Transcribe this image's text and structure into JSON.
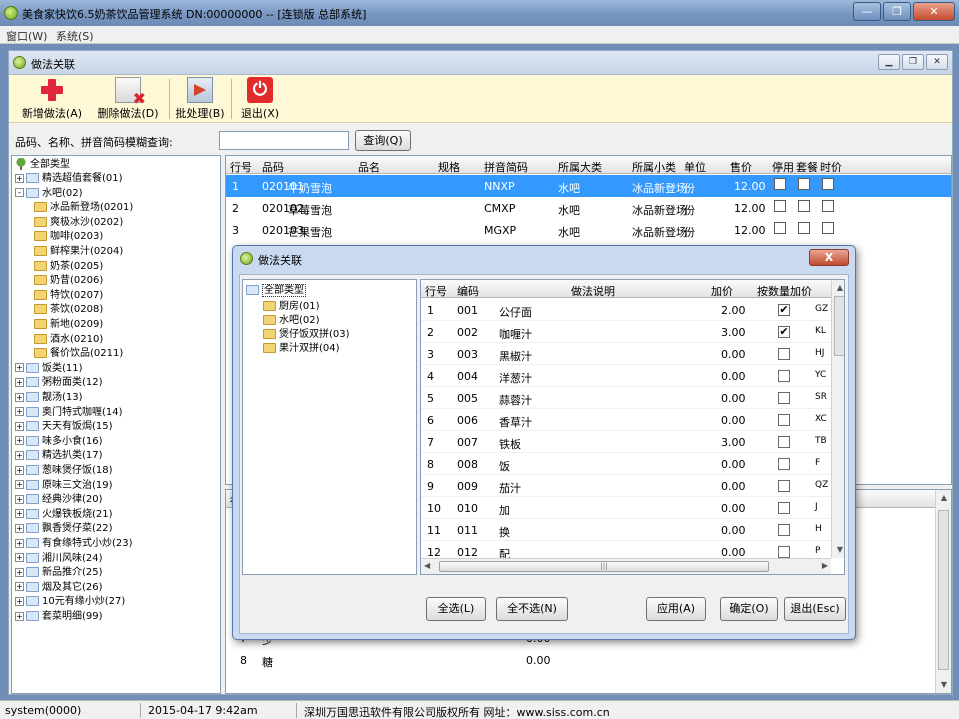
{
  "window": {
    "title": "美食家快饮6.5奶茶饮品管理系统 DN:00000000 -- [连锁版 总部系统]"
  },
  "menubar": {
    "items": [
      "窗口(W)",
      "系统(S)"
    ]
  },
  "child": {
    "title": "做法关联"
  },
  "toolbar": {
    "add": "新增做法(A)",
    "delete": "删除做法(D)",
    "batch": "批处理(B)",
    "exit": "退出(X)"
  },
  "search": {
    "label": "品码、名称、拼音简码模糊查询:",
    "value": "",
    "button": "查询(Q)"
  },
  "tree": {
    "root": "全部类型",
    "items": [
      {
        "label": "精选超值套餐(01)",
        "level": 1,
        "exp": "+"
      },
      {
        "label": "水吧(02)",
        "level": 1,
        "exp": "-"
      },
      {
        "label": "冰品新登场(0201)",
        "level": 2,
        "exp": ""
      },
      {
        "label": "爽极冰沙(0202)",
        "level": 2,
        "exp": ""
      },
      {
        "label": "咖啡(0203)",
        "level": 2,
        "exp": ""
      },
      {
        "label": "鲜榨果汁(0204)",
        "level": 2,
        "exp": ""
      },
      {
        "label": "奶茶(0205)",
        "level": 2,
        "exp": ""
      },
      {
        "label": "奶昔(0206)",
        "level": 2,
        "exp": ""
      },
      {
        "label": "特饮(0207)",
        "level": 2,
        "exp": ""
      },
      {
        "label": "茶饮(0208)",
        "level": 2,
        "exp": ""
      },
      {
        "label": "新地(0209)",
        "level": 2,
        "exp": ""
      },
      {
        "label": "酒水(0210)",
        "level": 2,
        "exp": ""
      },
      {
        "label": "餐价饮品(0211)",
        "level": 2,
        "exp": ""
      },
      {
        "label": "饭类(11)",
        "level": 1,
        "exp": "+"
      },
      {
        "label": "粥粉面类(12)",
        "level": 1,
        "exp": "+"
      },
      {
        "label": "靓汤(13)",
        "level": 1,
        "exp": "+"
      },
      {
        "label": "奥门特式咖喱(14)",
        "level": 1,
        "exp": "+"
      },
      {
        "label": "天天有饭焗(15)",
        "level": 1,
        "exp": "+"
      },
      {
        "label": "味多小食(16)",
        "level": 1,
        "exp": "+"
      },
      {
        "label": "精选扒类(17)",
        "level": 1,
        "exp": "+"
      },
      {
        "label": "葱味煲仔饭(18)",
        "level": 1,
        "exp": "+"
      },
      {
        "label": "原味三文治(19)",
        "level": 1,
        "exp": "+"
      },
      {
        "label": "经典沙律(20)",
        "level": 1,
        "exp": "+"
      },
      {
        "label": "火爆铁板烧(21)",
        "level": 1,
        "exp": "+"
      },
      {
        "label": "飘香煲仔菜(22)",
        "level": 1,
        "exp": "+"
      },
      {
        "label": "有食缘特式小炒(23)",
        "level": 1,
        "exp": "+"
      },
      {
        "label": "湘川风味(24)",
        "level": 1,
        "exp": "+"
      },
      {
        "label": "新品推介(25)",
        "level": 1,
        "exp": "+"
      },
      {
        "label": "烟及其它(26)",
        "level": 1,
        "exp": "+"
      },
      {
        "label": "10元有缘小炒(27)",
        "level": 1,
        "exp": "+"
      },
      {
        "label": "套菜明细(99)",
        "level": 1,
        "exp": "+"
      }
    ]
  },
  "grid": {
    "headers": [
      "行号",
      "品码",
      "品名",
      "规格",
      "拼音简码",
      "所属大类",
      "所属小类",
      "单位",
      "售价",
      "停用",
      "套餐",
      "时价"
    ],
    "rows": [
      [
        "1",
        "020101",
        "牛奶雪泡",
        "",
        "NNXP",
        "水吧",
        "冰品新登场",
        "份",
        "12.00"
      ],
      [
        "2",
        "020102",
        "草莓雪泡",
        "",
        "CMXP",
        "水吧",
        "冰品新登场",
        "份",
        "12.00"
      ],
      [
        "3",
        "020103",
        "芒果雪泡",
        "",
        "MGXP",
        "水吧",
        "冰品新登场",
        "份",
        "12.00"
      ]
    ]
  },
  "grid2": {
    "header_first": "行",
    "rows": [
      [
        "7",
        "少",
        "0.00"
      ],
      [
        "8",
        "糖",
        "0.00"
      ]
    ]
  },
  "dialog": {
    "title": "做法关联",
    "close": "X",
    "tree": {
      "root": "全部类型",
      "items": [
        "厨房(01)",
        "水吧(02)",
        "煲仔饭双拼(03)",
        "果汁双拼(04)"
      ]
    },
    "headers": [
      "行号",
      "编码",
      "做法说明",
      "加价",
      "按数量加价",
      ""
    ],
    "rows": [
      {
        "n": "1",
        "code": "001",
        "desc": "公仔面",
        "price": "2.00",
        "checked": true,
        "py": "GZ"
      },
      {
        "n": "2",
        "code": "002",
        "desc": "咖喱汁",
        "price": "3.00",
        "checked": true,
        "py": "KL"
      },
      {
        "n": "3",
        "code": "003",
        "desc": "黑椒汁",
        "price": "0.00",
        "checked": false,
        "py": "HJ"
      },
      {
        "n": "4",
        "code": "004",
        "desc": "洋葱汁",
        "price": "0.00",
        "checked": false,
        "py": "YC"
      },
      {
        "n": "5",
        "code": "005",
        "desc": "蒜蓉汁",
        "price": "0.00",
        "checked": false,
        "py": "SR"
      },
      {
        "n": "6",
        "code": "006",
        "desc": "香草汁",
        "price": "0.00",
        "checked": false,
        "py": "XC"
      },
      {
        "n": "7",
        "code": "007",
        "desc": "铁板",
        "price": "3.00",
        "checked": false,
        "py": "TB"
      },
      {
        "n": "8",
        "code": "008",
        "desc": "饭",
        "price": "0.00",
        "checked": false,
        "py": "F"
      },
      {
        "n": "9",
        "code": "009",
        "desc": "茄汁",
        "price": "0.00",
        "checked": false,
        "py": "QZ"
      },
      {
        "n": "10",
        "code": "010",
        "desc": "加",
        "price": "0.00",
        "checked": false,
        "py": "J"
      },
      {
        "n": "11",
        "code": "011",
        "desc": "换",
        "price": "0.00",
        "checked": false,
        "py": "H"
      },
      {
        "n": "12",
        "code": "012",
        "desc": "配",
        "price": "0.00",
        "checked": false,
        "py": "P"
      }
    ],
    "buttons": {
      "select_all": "全选(L)",
      "select_none": "全不选(N)",
      "apply": "应用(A)",
      "ok": "确定(O)",
      "exit": "退出(Esc)"
    }
  },
  "status": {
    "user": "system(0000)",
    "datetime": "2015-04-17 9:42am",
    "copyright": "深圳万国思迅软件有限公司版权所有 网址：www.siss.com.cn"
  },
  "colors": {
    "selection": "#3399ff",
    "toolbar_bg": "#fff8d6",
    "close_red": "#c14a2f"
  }
}
